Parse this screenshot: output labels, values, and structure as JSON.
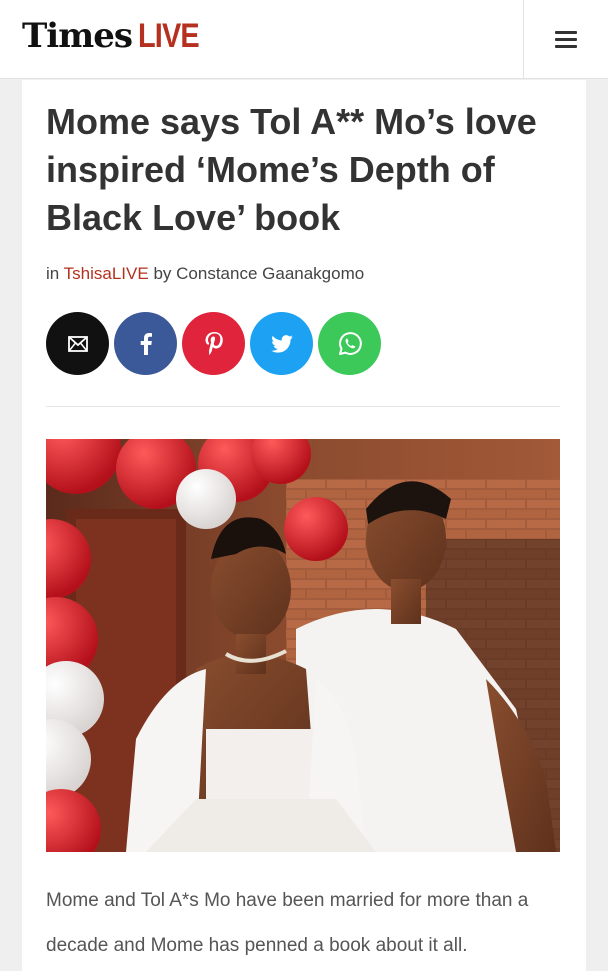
{
  "header": {
    "logo_times": "Times",
    "logo_live": "LIVE",
    "menu_icon": "hamburger-menu-icon"
  },
  "article": {
    "title": "Mome says Tol A** Mo’s love inspired ‘Mome’s Depth of Black Love’ book",
    "byline": {
      "prefix": "in",
      "section": "TshisaLIVE",
      "by": "by",
      "author": "Constance Gaanakgomo"
    },
    "share": [
      {
        "name": "email-share-button",
        "icon": "mail-icon",
        "color": "#111111"
      },
      {
        "name": "facebook-share-button",
        "icon": "facebook-icon",
        "color": "#3b5998"
      },
      {
        "name": "pinterest-share-button",
        "icon": "pinterest-icon",
        "color": "#e0243b"
      },
      {
        "name": "twitter-share-button",
        "icon": "twitter-icon",
        "color": "#1da1f2"
      },
      {
        "name": "whatsapp-share-button",
        "icon": "whatsapp-icon",
        "color": "#3cc95a"
      }
    ],
    "body": "Mome and Tol A*s Mo have been married for more than a decade and Mome has penned a book about it all."
  },
  "colors": {
    "brand_red": "#b5301f",
    "title_text": "#333333"
  }
}
